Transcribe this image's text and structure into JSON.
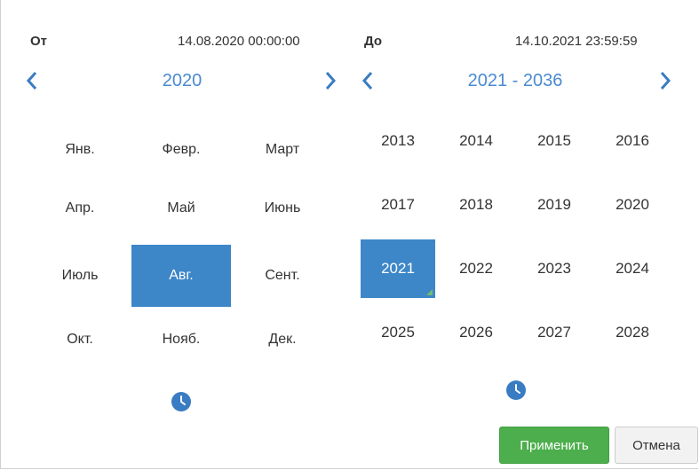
{
  "colors": {
    "accent": "#3d86c8",
    "title_text": "#4a8ad0",
    "apply": "#4cae4c",
    "cancel": "#f2f2f2"
  },
  "from": {
    "label": "От",
    "datetime": "14.08.2020 00:00:00",
    "title": "2020",
    "months": [
      "Янв.",
      "Февр.",
      "Март",
      "Апр.",
      "Май",
      "Июнь",
      "Июль",
      "Авг.",
      "Сент.",
      "Окт.",
      "Нояб.",
      "Дек."
    ],
    "selected_month": "Авг.",
    "clock_icon": "clock-icon"
  },
  "to": {
    "label": "До",
    "datetime": "14.10.2021 23:59:59",
    "title": "2021 - 2036",
    "years": [
      "2013",
      "2014",
      "2015",
      "2016",
      "2017",
      "2018",
      "2019",
      "2020",
      "2021",
      "2022",
      "2023",
      "2024",
      "2025",
      "2026",
      "2027",
      "2028"
    ],
    "selected_year": "2021",
    "clock_icon": "clock-icon"
  },
  "buttons": {
    "apply": "Применить",
    "cancel": "Отмена"
  }
}
